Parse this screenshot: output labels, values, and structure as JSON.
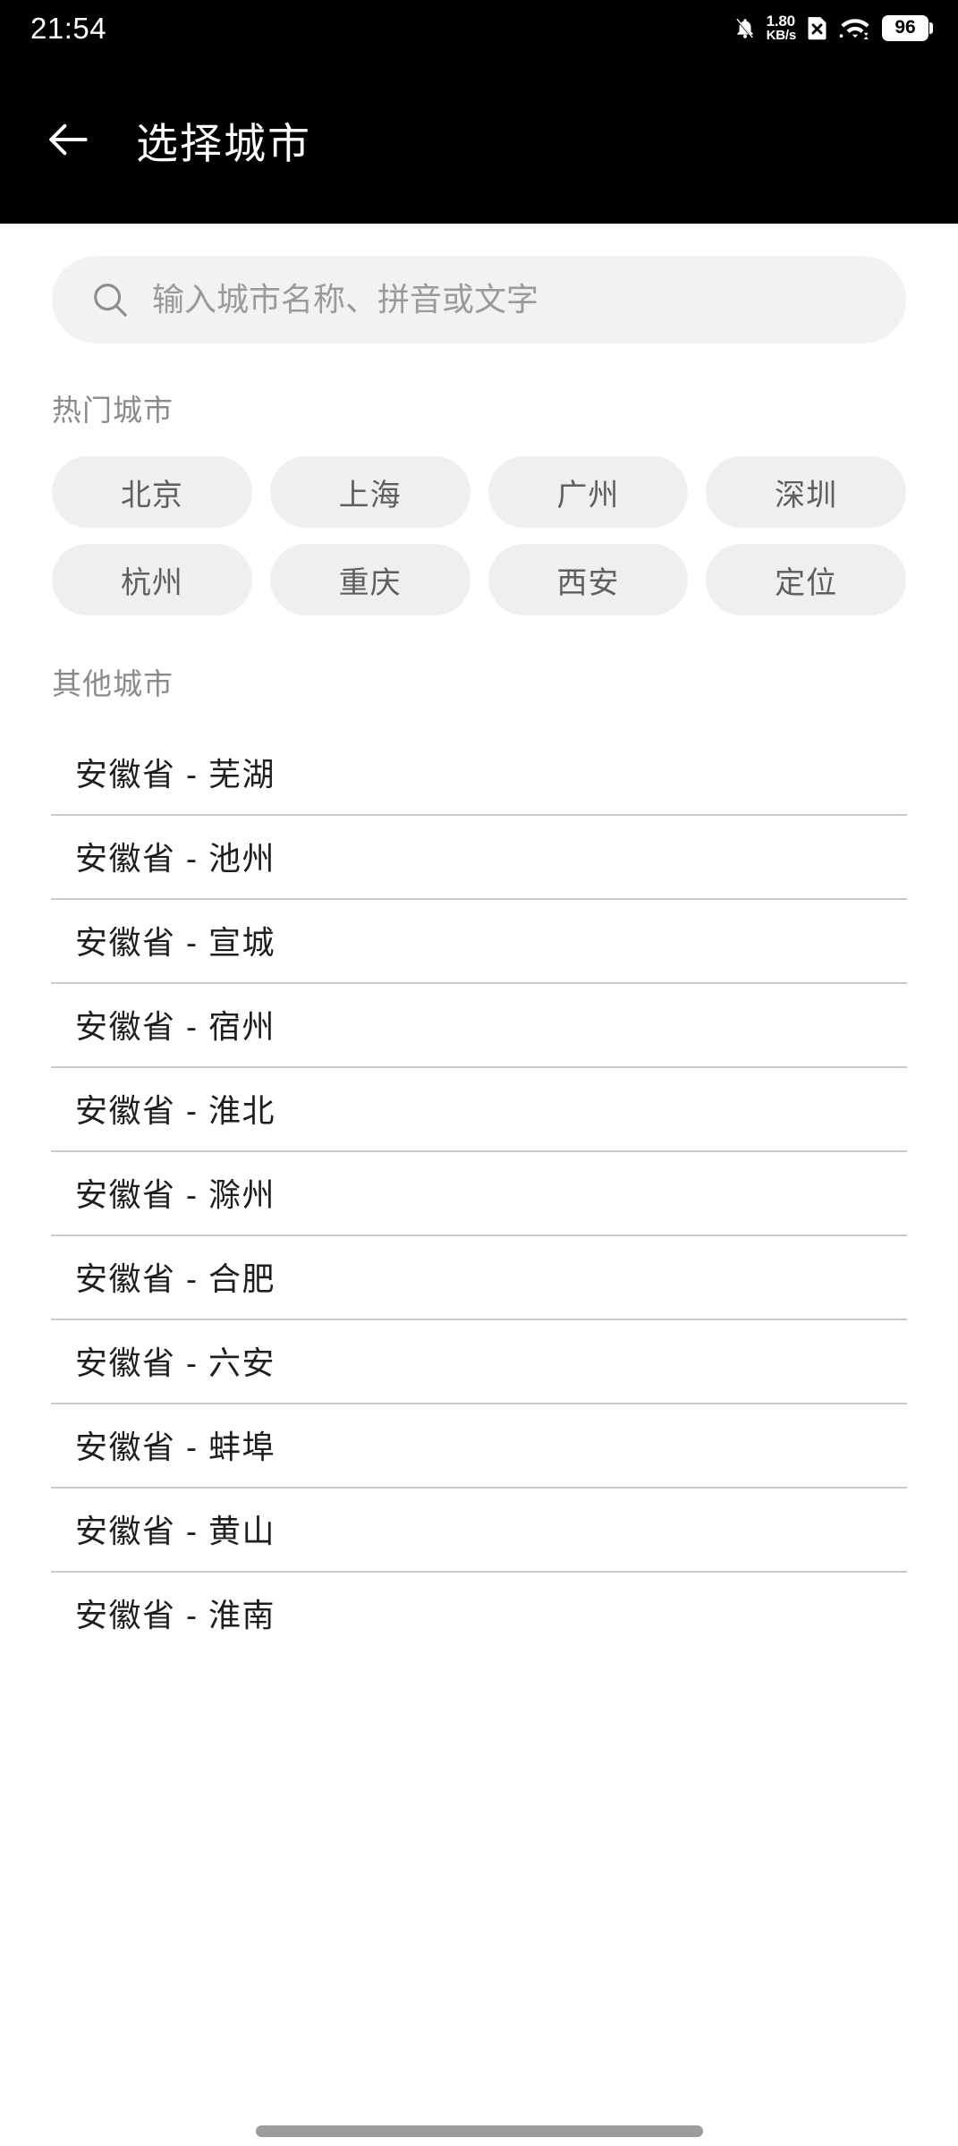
{
  "status_bar": {
    "time": "21:54",
    "network_speed_value": "1.80",
    "network_speed_unit": "KB/s",
    "battery_level": "96",
    "icons": [
      "mute-bell-icon",
      "sim-card-off-icon",
      "wifi-icon",
      "battery-icon"
    ]
  },
  "app_bar": {
    "back_icon": "back-arrow-icon",
    "title": "选择城市"
  },
  "search": {
    "icon": "search-icon",
    "placeholder": "输入城市名称、拼音或文字",
    "value": ""
  },
  "hot_cities": {
    "heading": "热门城市",
    "chips": [
      "北京",
      "上海",
      "广州",
      "深圳",
      "杭州",
      "重庆",
      "西安",
      "定位"
    ]
  },
  "other_cities": {
    "heading": "其他城市",
    "rows": [
      "安徽省 - 芜湖",
      "安徽省 - 池州",
      "安徽省 - 宣城",
      "安徽省 - 宿州",
      "安徽省 - 淮北",
      "安徽省 - 滁州",
      "安徽省 - 合肥",
      "安徽省 - 六安",
      "安徽省 - 蚌埠",
      "安徽省 - 黄山",
      "安徽省 - 淮南"
    ]
  },
  "colors": {
    "app_bar_bg": "#000000",
    "page_bg": "#ffffff",
    "search_bg": "#f2f2f2",
    "chip_bg": "#efefef",
    "chip_text": "#5e5e5e",
    "section_title": "#8a8a8a",
    "row_text": "#211d1c",
    "divider": "#c9c9c9",
    "gesture_bar": "#9c9c9c"
  }
}
